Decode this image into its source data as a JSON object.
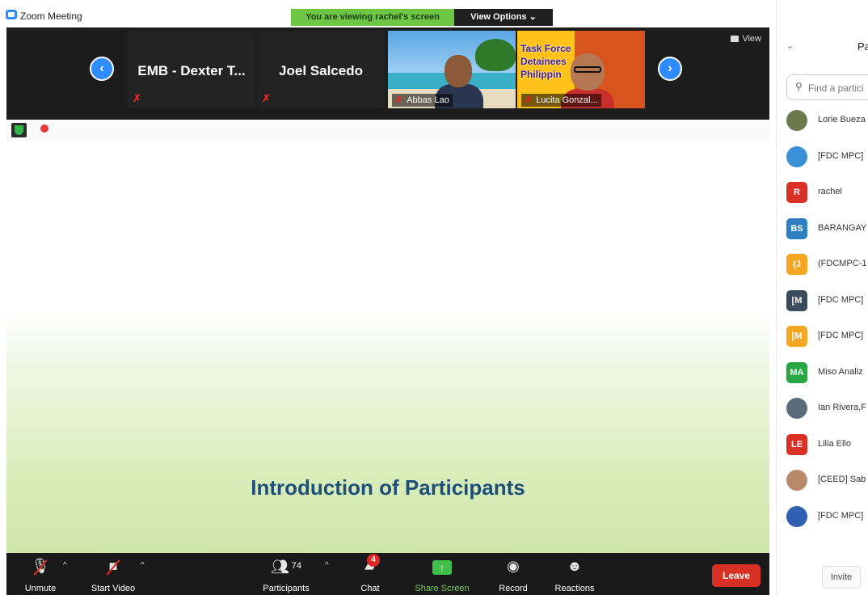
{
  "window": {
    "title": "Zoom Meeting"
  },
  "banner": {
    "viewing_text": "You are viewing rachel's screen",
    "view_options_label": "View Options ⌄"
  },
  "strip": {
    "prev_arrow": "‹",
    "next_arrow": "›",
    "view_label": "View",
    "tiles": [
      {
        "name": "EMB - Dexter T...",
        "muted": true
      },
      {
        "name": "Joel Salcedo",
        "muted": true
      },
      {
        "name": "Abbas Lao",
        "muted": true
      },
      {
        "name": "Lucita Gonzal...",
        "muted": true,
        "poster_text": "Task Force Detainees Philippin"
      }
    ]
  },
  "slide": {
    "title": "Introduction of Participants"
  },
  "toolbar": {
    "unmute": "Unmute",
    "start_video": "Start Video",
    "participants": "Participants",
    "participants_count": "74",
    "chat": "Chat",
    "chat_badge": "4",
    "share_screen": "Share Screen",
    "record": "Record",
    "reactions": "Reactions",
    "leave": "Leave"
  },
  "panel": {
    "title": "Pa",
    "search_placeholder": "Find a partici",
    "invite": "Invite",
    "participants": [
      {
        "name": "Lorie Bueza",
        "initials": "",
        "color": "#6b7a4a"
      },
      {
        "name": "[FDC MPC]",
        "initials": "",
        "color": "#3a8fd6"
      },
      {
        "name": "rachel",
        "initials": "R",
        "color": "#d93025"
      },
      {
        "name": "BARANGAY",
        "initials": "BS",
        "color": "#2d7fc1"
      },
      {
        "name": "(FDCMPC-1",
        "initials": "(J",
        "color": "#f5a623"
      },
      {
        "name": "[FDC MPC]",
        "initials": "[M",
        "color": "#3b4a5e"
      },
      {
        "name": "[FDC MPC]",
        "initials": "[M",
        "color": "#f5a623"
      },
      {
        "name": "Miso Analiz",
        "initials": "MA",
        "color": "#27a844"
      },
      {
        "name": "Ian Rivera,F",
        "initials": "",
        "color": "#5a6b7c"
      },
      {
        "name": "Lilia Ello",
        "initials": "LE",
        "color": "#d93025"
      },
      {
        "name": "[CEED] Sab",
        "initials": "",
        "color": "#b98a6a"
      },
      {
        "name": "[FDC MPC]",
        "initials": "",
        "color": "#2f5fb0"
      }
    ]
  },
  "colors": {
    "accent": "#2d8cff",
    "leave": "#d93025",
    "share_green": "#6cc644",
    "slide_title": "#1f4e79"
  }
}
